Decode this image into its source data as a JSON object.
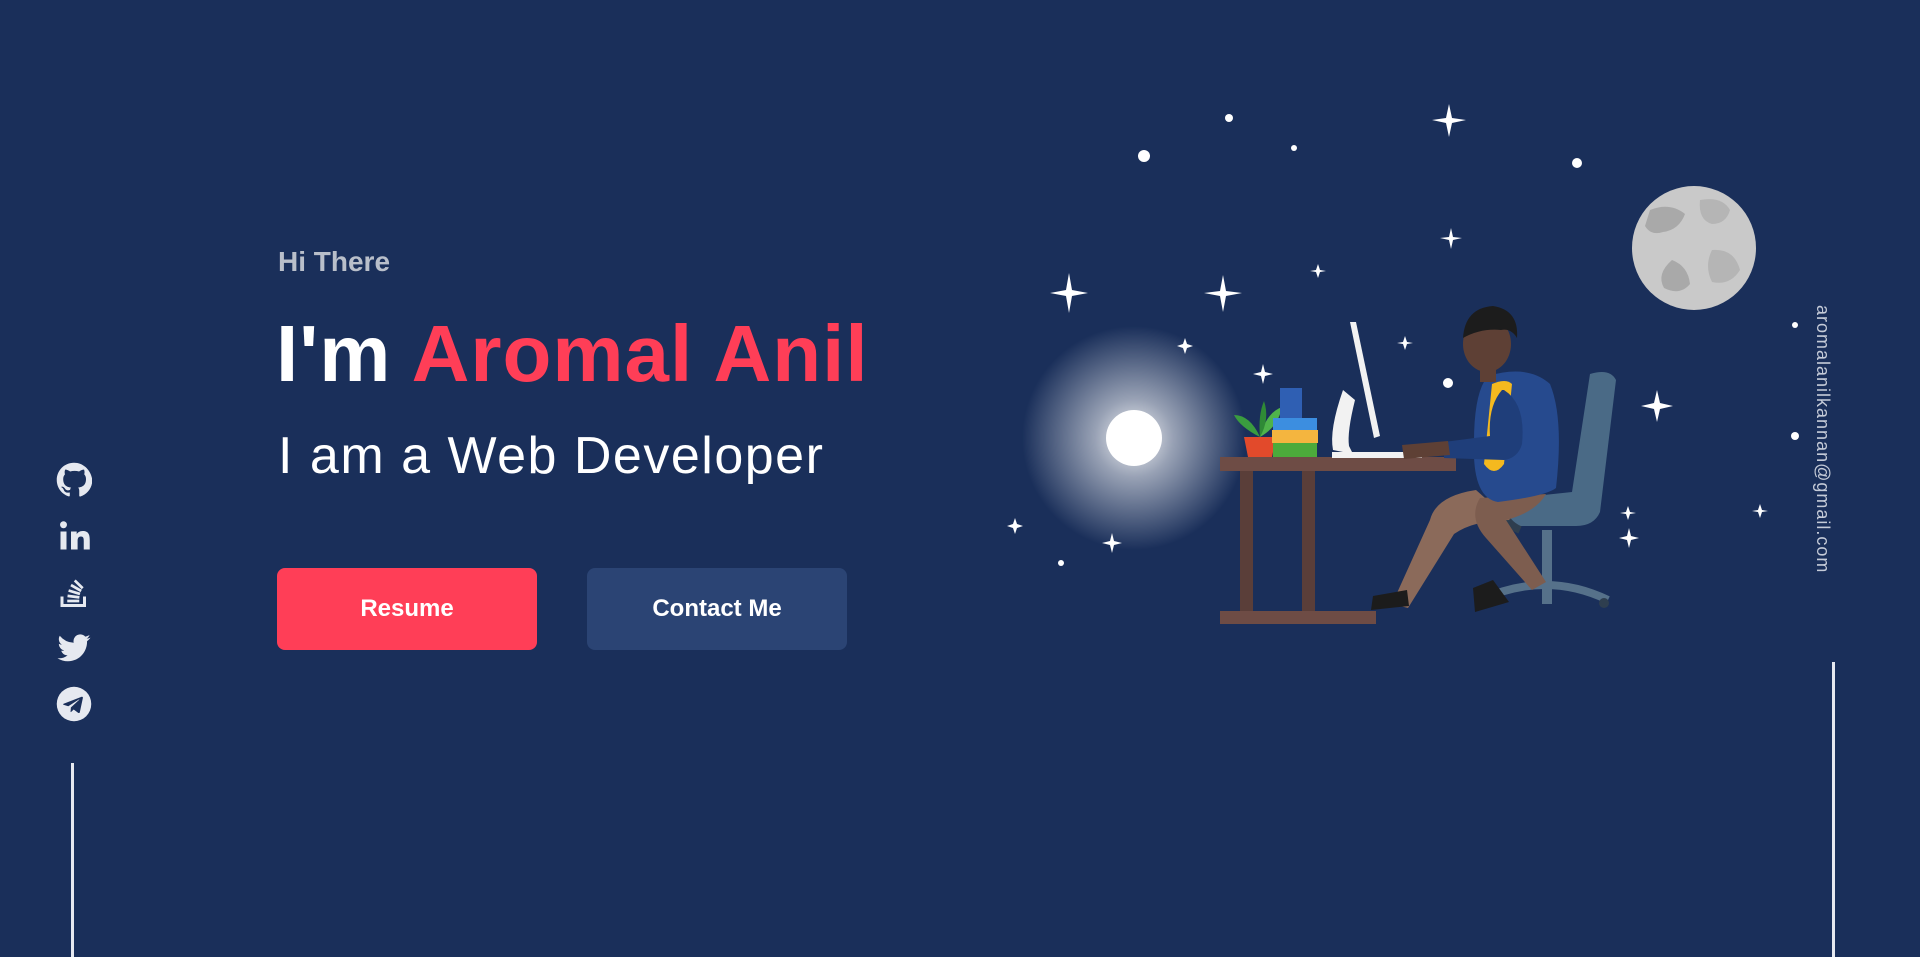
{
  "hero": {
    "greeting": "Hi There",
    "title_prefix": "I'm ",
    "name": "Aromal Anil",
    "subtitle": "I am a Web Developer"
  },
  "buttons": {
    "resume": "Resume",
    "contact": "Contact Me"
  },
  "social": {
    "icons": [
      "github-icon",
      "linkedin-icon",
      "stackoverflow-icon",
      "twitter-icon",
      "telegram-icon"
    ]
  },
  "contact": {
    "email": "aromalanilkannan@gmail.com"
  },
  "colors": {
    "background": "#1a2f5a",
    "accent": "#ff3e57",
    "secondary_button": "#2b4474"
  }
}
